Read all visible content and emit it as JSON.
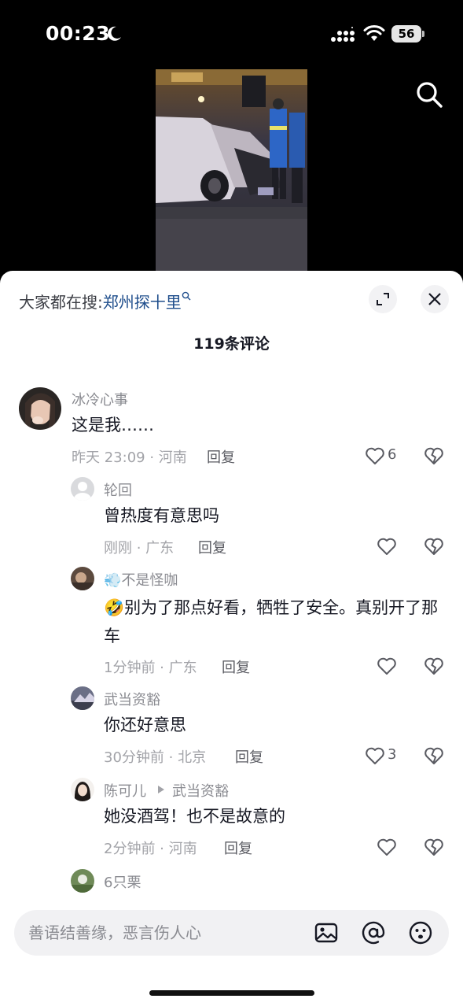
{
  "status_bar": {
    "time": "00:23",
    "battery": "56",
    "icons": [
      "moon-icon",
      "cellular-signal-icon",
      "wifi-icon",
      "battery-icon"
    ]
  },
  "top": {
    "search_icon": "search-icon"
  },
  "panel": {
    "hot_search_prefix": "大家都在搜:",
    "hot_search_keyword": "郑州探十里",
    "comment_count_title": "119条评论",
    "expand_icon": "expand-icon",
    "close_icon": "close-icon"
  },
  "comments": [
    {
      "username": "冰冷心事",
      "text": "这是我……",
      "meta": "昨天 23:09 · 河南",
      "reply_label": "回复",
      "likes": "6"
    },
    {
      "username": "轮回",
      "text": "曾热度有意思吗",
      "meta": "刚刚 · 广东",
      "reply_label": "回复",
      "likes": ""
    },
    {
      "username": "💨不是怪咖",
      "text": "🤣别为了那点好看，牺牲了安全。真别开了那车",
      "meta": "1分钟前 · 广东",
      "reply_label": "回复",
      "likes": ""
    },
    {
      "username": "武当资豁",
      "text": "你还好意思",
      "meta": "30分钟前 · 北京",
      "reply_label": "回复",
      "likes": "3"
    },
    {
      "username": "陈可儿",
      "reply_to": "武当资豁",
      "text": "她没酒驾！也不是故意的",
      "meta": "2分钟前 · 河南",
      "reply_label": "回复",
      "likes": ""
    },
    {
      "username": "6只栗"
    }
  ],
  "input_bar": {
    "placeholder": "善语结善缘，恶言伤人心",
    "icons": [
      "image-icon",
      "at-icon",
      "emoji-icon"
    ]
  },
  "colors": {
    "link_blue": "#1f4e8c",
    "secondary_text": "#8a8b91",
    "primary_text": "#161823"
  }
}
